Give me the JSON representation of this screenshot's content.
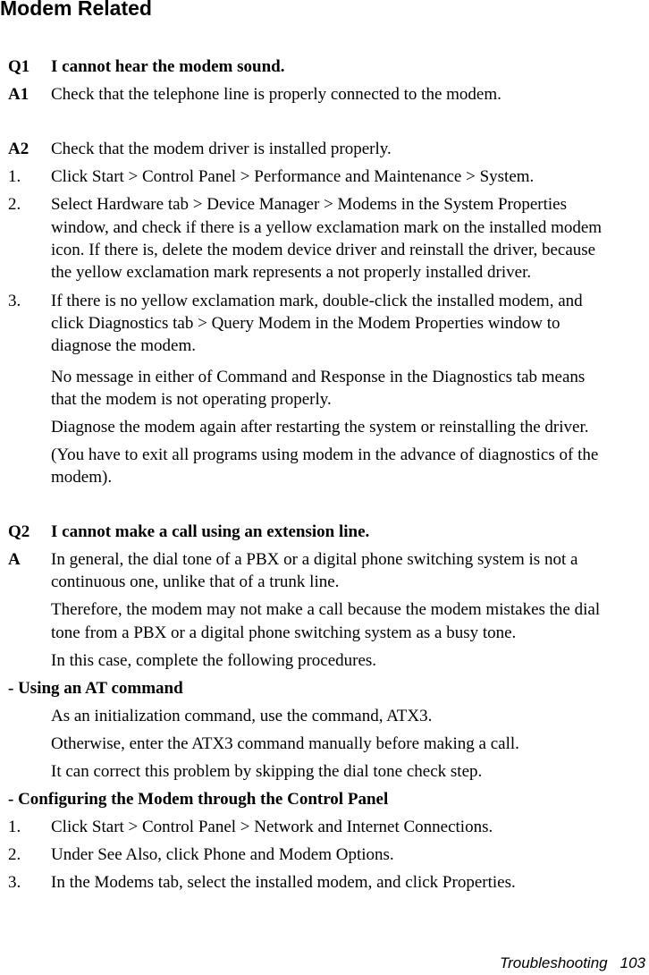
{
  "title": "Modem Related",
  "q1": {
    "label": "Q1",
    "question": "I cannot hear the modem sound.",
    "a1_label": "A1",
    "a1_text": "Check that the telephone line is properly connected to the modem.",
    "a2_label": "A2",
    "a2_text": "Check that the modem driver is installed properly.",
    "steps": [
      {
        "num": "1.",
        "lines": [
          "Click Start > Control Panel > Performance and Maintenance > System."
        ]
      },
      {
        "num": "2.",
        "lines": [
          "Select Hardware tab > Device Manager > Modems in the System Properties",
          "window, and check if there is a yellow exclamation mark on the installed modem",
          "icon. If there is, delete the modem device driver and reinstall the driver, because",
          "the yellow exclamation mark represents a not properly installed driver."
        ]
      },
      {
        "num": "3.",
        "lines": [
          "If there is no yellow exclamation mark, double-click the installed modem, and",
          "click Diagnostics tab > Query Modem in the Modem Properties window to",
          "diagnose the modem."
        ]
      }
    ],
    "notes": [
      [
        "No message in either of Command and Response in the Diagnostics tab means",
        "that the modem is not operating properly."
      ],
      [
        "Diagnose the modem again after restarting the system or reinstalling the driver."
      ],
      [
        "(You have to exit all programs using modem in the advance of diagnostics of the",
        "modem)."
      ]
    ]
  },
  "q2": {
    "label": "Q2",
    "question": "I cannot make a call using an extension line.",
    "a_label": "A",
    "paragraphs": [
      [
        "In general, the dial tone of a PBX or a digital phone switching system is not a",
        "continuous one, unlike that of a trunk line."
      ],
      [
        "Therefore, the modem may not make a call because the modem mistakes the dial",
        "tone from a PBX or a digital phone switching system as a busy tone."
      ],
      [
        "In this case, complete the following procedures."
      ]
    ],
    "at_heading": "- Using an AT command",
    "at_lines": [
      "As an initialization command, use the command, ATX3.",
      "Otherwise, enter the ATX3 command manually before making a call.",
      "It can correct this problem by skipping the dial tone check step."
    ],
    "cp_heading": "- Configuring the Modem through the Control Panel",
    "cp_steps": [
      {
        "num": "1.",
        "text": "Click Start > Control Panel > Network and Internet Connections."
      },
      {
        "num": "2.",
        "text": "Under See Also, click Phone and Modem Options."
      },
      {
        "num": "3.",
        "text": "In the Modems tab, select the installed modem, and click Properties."
      }
    ]
  },
  "footer": {
    "section": "Troubleshooting",
    "page": "103"
  }
}
